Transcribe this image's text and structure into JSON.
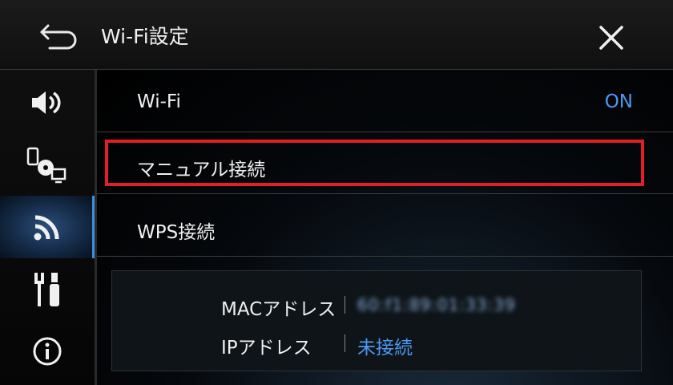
{
  "header": {
    "title": "Wi-Fi設定"
  },
  "sidebar": {
    "items": [
      {
        "icon": "speaker-icon"
      },
      {
        "icon": "devices-icon"
      },
      {
        "icon": "wifi-icon",
        "active": true
      },
      {
        "icon": "tools-icon"
      },
      {
        "icon": "info-icon"
      }
    ]
  },
  "menu": {
    "wifi": {
      "label": "Wi-Fi",
      "value": "ON"
    },
    "manual": {
      "label": "マニュアル接続"
    },
    "wps": {
      "label": "WPS接続"
    }
  },
  "info": {
    "mac_label": "MACアドレス",
    "mac_value": "60:f1:89:01:33:39",
    "ip_label": "IPアドレス",
    "ip_value": "未接続"
  },
  "colors": {
    "accent": "#4a9af0",
    "highlight": "#e41e26"
  }
}
